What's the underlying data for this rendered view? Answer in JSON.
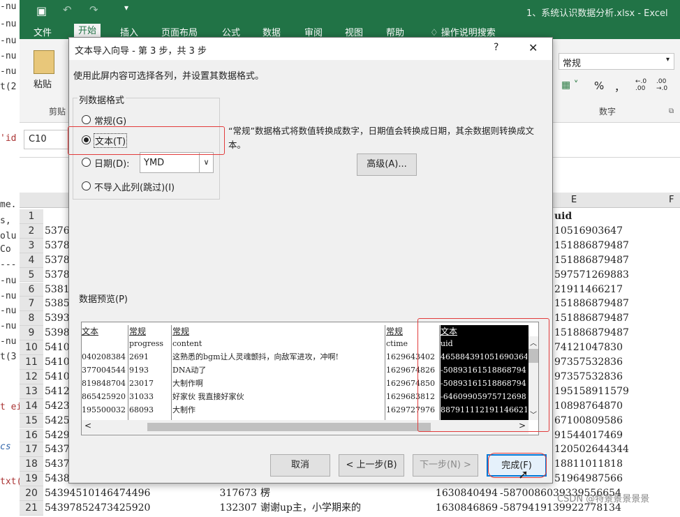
{
  "terminal_lines": [
    "-nu",
    "-nu",
    "-nu",
    "-nu",
    "-nu",
    "t(2",
    "'id",
    "me.",
    "s,",
    "olu",
    " Co",
    "---",
    "-nu",
    "-nu",
    "-nu",
    "-nu",
    "-nu",
    "t(3",
    "t ei",
    "cs",
    "txt("
  ],
  "excel": {
    "filename": "1、系统认识数据分析.xlsx",
    "app_suffix": "- Excel",
    "tabs": [
      "文件",
      "开始",
      "插入",
      "页面布局",
      "公式",
      "数据",
      "审阅",
      "视图",
      "帮助",
      "操作说明搜索"
    ],
    "clipboard": {
      "paste": "粘贴",
      "group": "剪贴"
    },
    "number_format": {
      "value": "常规",
      "percent": "%",
      "comma": "，",
      "group": "数字",
      "inc_decimal": "←.0 .00",
      "dec_decimal": ".00 →.0"
    },
    "name_box": "C10",
    "col_e_header": "E",
    "col_f_header": "F",
    "uid_header": "uid",
    "rows": [
      {
        "n": "1",
        "a": "",
        "e": "uid"
      },
      {
        "n": "2",
        "a": "5376",
        "e": "10516903647"
      },
      {
        "n": "3",
        "a": "5378",
        "e": "151886879487"
      },
      {
        "n": "4",
        "a": "5378",
        "e": "151886879487"
      },
      {
        "n": "5",
        "a": "5378",
        "e": "597571269883"
      },
      {
        "n": "6",
        "a": "5381",
        "e": "21911466217"
      },
      {
        "n": "7",
        "a": "5385",
        "e": "151886879487"
      },
      {
        "n": "8",
        "a": "5393",
        "e": "151886879487"
      },
      {
        "n": "9",
        "a": "5398",
        "e": "151886879487"
      },
      {
        "n": "10",
        "a": "5410",
        "e": "74121047830"
      },
      {
        "n": "11",
        "a": "5410",
        "e": "97357532836"
      },
      {
        "n": "12",
        "a": "5410",
        "e": "97357532836"
      },
      {
        "n": "13",
        "a": "5412",
        "e": "195158911579"
      },
      {
        "n": "14",
        "a": "5423",
        "e": "10898764870"
      },
      {
        "n": "15",
        "a": "5425",
        "e": "67100809586"
      },
      {
        "n": "16",
        "a": "5429",
        "e": "91544017469"
      },
      {
        "n": "17",
        "a": "5437",
        "e": "120502644344"
      },
      {
        "n": "18",
        "a": "5437",
        "e": "18811011818"
      },
      {
        "n": "19",
        "a": "5438",
        "e": "51964987566"
      }
    ],
    "row20": {
      "n": "20",
      "a": "54394510146474496",
      "b": "317673",
      "c": "楞",
      "d": "1630840494",
      "e": "-5870086039339556654"
    },
    "row21": {
      "n": "21",
      "a": "54397852473425920",
      "b": "132307",
      "c": "谢谢up主，小学期来的",
      "d": "1630846869",
      "e": "-5879419139922778134"
    },
    "watermark": "CSDN @特景景景景景"
  },
  "dialog": {
    "title": "文本导入向导 - 第 3 步，共 3 步",
    "help": "?",
    "close": "✕",
    "instruction": "使用此屏内容可选择各列，并设置其数据格式。",
    "group_label": "列数据格式",
    "options": [
      {
        "label": "常规(G)",
        "checked": false
      },
      {
        "label": "文本(T)",
        "checked": true
      },
      {
        "label": "日期(D):",
        "checked": false
      },
      {
        "label": "不导入此列(跳过)(I)",
        "checked": false
      }
    ],
    "date_format": "YMD",
    "description": "“常规”数据格式将数值转换成数字，日期值会转换成日期，其余数据则转换成文本。",
    "advanced": "高级(A)...",
    "preview_label": "数据预览(P)",
    "preview_headers": [
      "文本",
      "常规",
      "常规",
      "常规",
      "文本"
    ],
    "preview_rows": [
      [
        "",
        "progress",
        "content",
        "ctime",
        "uid"
      ],
      [
        "040208384",
        "2691",
        "这熟悉的bgm让人灵魂颤抖，向敌军进攻，冲啊!",
        "1629643402",
        "465884391051690364"
      ],
      [
        "377004544",
        "9193",
        "DNA动了",
        "1629674826",
        "-50893161518868794"
      ],
      [
        "819848704",
        "23017",
        "大制作啊",
        "1629674850",
        "-50893161518868794"
      ],
      [
        "865425920",
        "31033",
        "好家伙 我直接好家伙",
        "1629683812",
        "-64609905975712698"
      ],
      [
        "195500032",
        "68093",
        "大制作",
        "1629727976",
        "887911112191146621"
      ]
    ],
    "buttons": {
      "cancel": "取消",
      "back": "< 上一步(B)",
      "next": "下一步(N) >",
      "finish": "完成(F)"
    }
  }
}
